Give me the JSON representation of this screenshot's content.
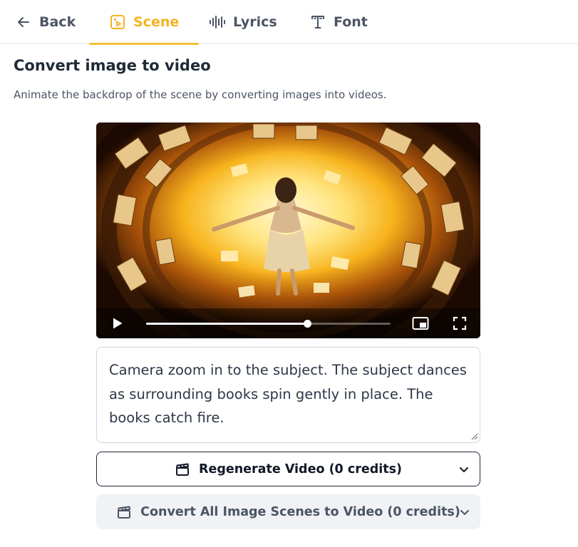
{
  "tabs": {
    "back": "Back",
    "scene": "Scene",
    "lyrics": "Lyrics",
    "font": "Font"
  },
  "section": {
    "title": "Convert image to video",
    "subtitle": "Animate the backdrop of the scene by converting images into videos."
  },
  "video": {
    "progress": 0.66
  },
  "prompt": {
    "value": "Camera zoom in to the subject. The subject dances as surrounding books spin gently in place. The books catch fire."
  },
  "buttons": {
    "regenerate": "Regenerate Video (0 credits)",
    "convert_all": "Convert All Image Scenes to Video (0 credits)"
  },
  "colors": {
    "accent": "#f5b21f",
    "text": "#1f2a37",
    "muted": "#4b5563"
  }
}
